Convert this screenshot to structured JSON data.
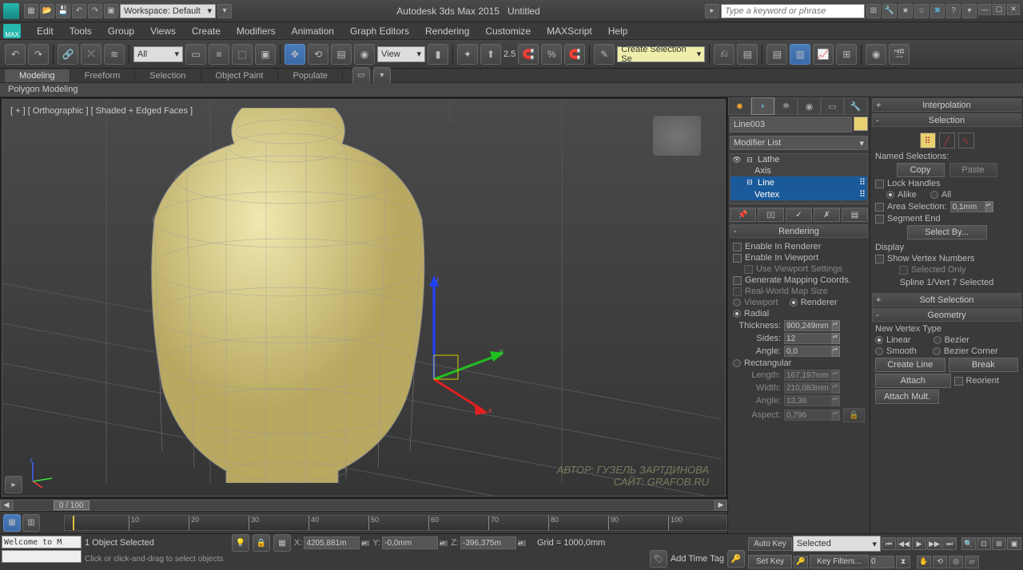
{
  "title": {
    "app": "Autodesk 3ds Max  2015",
    "doc": "Untitled"
  },
  "workspace_label": "Workspace: Default",
  "search_placeholder": "Type a keyword or phrase",
  "menus": [
    "Edit",
    "Tools",
    "Group",
    "Views",
    "Create",
    "Modifiers",
    "Animation",
    "Graph Editors",
    "Rendering",
    "Customize",
    "MAXScript",
    "Help"
  ],
  "toolbar": {
    "filter_dd": "All",
    "refsys_dd": "View",
    "snap_val": "2.5",
    "sel_set_dd": "Create Selection Se"
  },
  "ribbon": {
    "tabs": [
      "Modeling",
      "Freeform",
      "Selection",
      "Object Paint",
      "Populate"
    ],
    "panel": "Polygon Modeling"
  },
  "viewport": {
    "label": "[ + ] [ Orthographic ] [ Shaded + Edged Faces ]",
    "watermark_line1": "АВТОР: ГУЗЕЛЬ ЗАРТДИНОВА",
    "watermark_line2": "САЙТ: GRAFOB.RU"
  },
  "cmd": {
    "object_name": "Line003",
    "modifier_dd": "Modifier List",
    "stack": {
      "lathe": "Lathe",
      "axis": "Axis",
      "line": "Line",
      "vertex": "Vertex"
    }
  },
  "rollouts": {
    "interpolation": "Interpolation",
    "selection": "Selection",
    "named_sel": "Named Selections:",
    "copy": "Copy",
    "paste": "Paste",
    "lock_handles": "Lock Handles",
    "alike": "Alike",
    "all": "All",
    "area_sel": "Area Selection:",
    "area_val": "0,1mm",
    "segment_end": "Segment End",
    "select_by": "Select By...",
    "display": "Display",
    "show_vn": "Show Vertex Numbers",
    "sel_only": "Selected Only",
    "sel_info": "Spline 1/Vert 7 Selected",
    "soft_sel": "Soft Selection",
    "geometry": "Geometry",
    "nvt": "New Vertex Type",
    "linear": "Linear",
    "bezier": "Bezier",
    "smooth": "Smooth",
    "bez_corner": "Bezier Corner",
    "create_line": "Create Line",
    "break": "Break",
    "attach": "Attach",
    "reorient": "Reorient",
    "attach_mult": "Attach Mult.",
    "rendering": "Rendering",
    "enable_r": "Enable In Renderer",
    "enable_v": "Enable In Viewport",
    "use_vp": "Use Viewport Settings",
    "gen_map": "Generate Mapping Coords.",
    "rw_map": "Real-World Map Size",
    "vp_radio": "Viewport",
    "rn_radio": "Renderer",
    "radial": "Radial",
    "thickness": "Thickness:",
    "thickness_v": "900,249mm",
    "sides": "Sides:",
    "sides_v": "12",
    "angle": "Angle:",
    "angle_v": "0,0",
    "rect": "Rectangular",
    "length": "Length:",
    "length_v": "167,197mm",
    "width": "Width:",
    "width_v": "210,083mm",
    "angle2": "Angle:",
    "angle2_v": "13,36",
    "aspect": "Aspect:",
    "aspect_v": "0,796"
  },
  "timeslider": {
    "pos": "0 / 100"
  },
  "timeline_ticks": [
    "10",
    "20",
    "30",
    "40",
    "50",
    "60",
    "70",
    "80",
    "90",
    "100"
  ],
  "status": {
    "welcome": "Welcome to M",
    "sel": "1 Object Selected",
    "x": "4205,881m",
    "y": "-0,0mm",
    "z": "-396,375m",
    "grid": "Grid = 1000,0mm",
    "prompt": "Click or click-and-drag to select objects",
    "add_tag": "Add Time Tag",
    "auto_key": "Auto Key",
    "set_key": "Set Key",
    "key_filter_dd": "Selected",
    "key_filters": "Key Filters..."
  }
}
